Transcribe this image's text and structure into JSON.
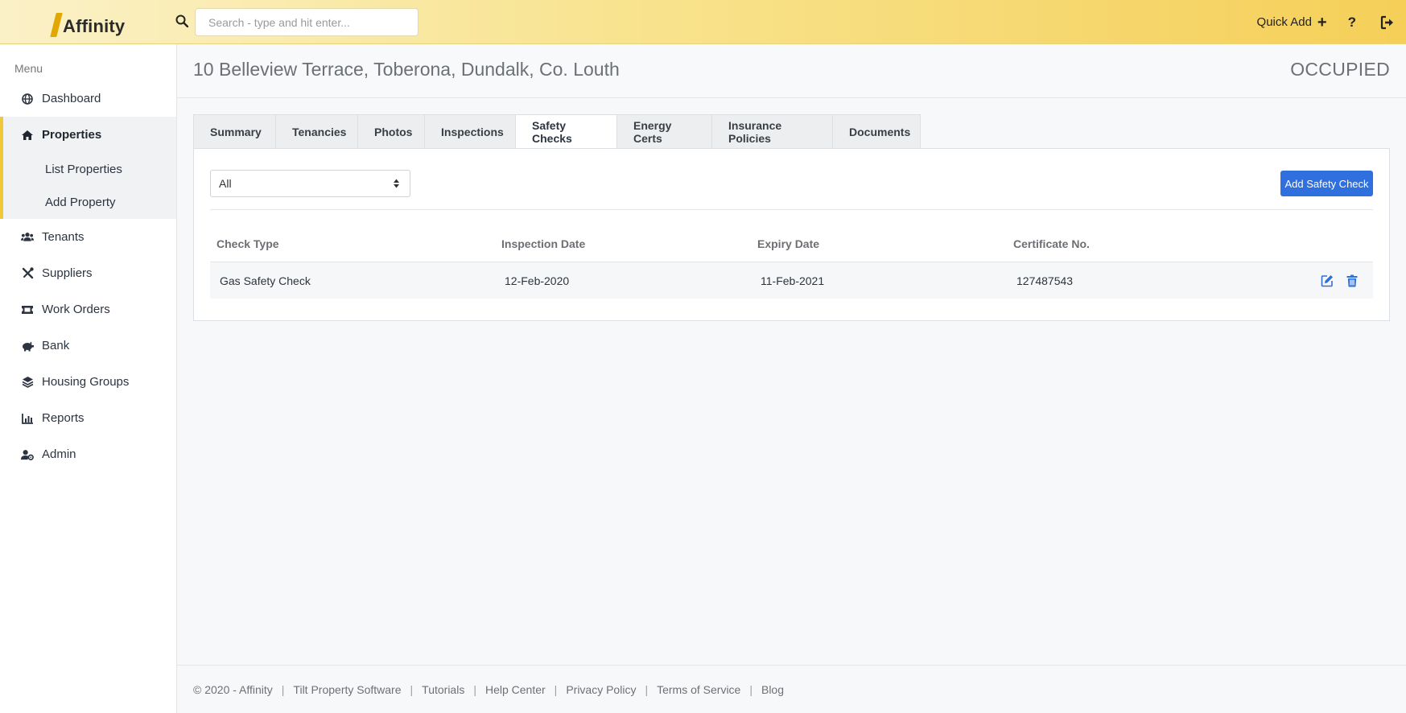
{
  "app": {
    "logo_text": "Affinity"
  },
  "topbar": {
    "search_placeholder": "Search - type and hit enter...",
    "quick_add_label": "Quick Add",
    "help_label": "?"
  },
  "sidebar": {
    "menu_label": "Menu",
    "items": [
      {
        "label": "Dashboard",
        "icon": "globe-icon"
      },
      {
        "label": "Properties",
        "icon": "home-icon",
        "active": true,
        "children": [
          {
            "label": "List Properties"
          },
          {
            "label": "Add Property"
          }
        ]
      },
      {
        "label": "Tenants",
        "icon": "users-icon"
      },
      {
        "label": "Suppliers",
        "icon": "tools-icon"
      },
      {
        "label": "Work Orders",
        "icon": "ticket-icon"
      },
      {
        "label": "Bank",
        "icon": "piggy-bank-icon"
      },
      {
        "label": "Housing Groups",
        "icon": "layers-icon"
      },
      {
        "label": "Reports",
        "icon": "chart-icon"
      },
      {
        "label": "Admin",
        "icon": "user-cog-icon"
      }
    ]
  },
  "page": {
    "title": "10 Belleview Terrace, Toberona, Dundalk, Co. Louth",
    "status": "OCCUPIED"
  },
  "tabs": [
    {
      "label": "Summary"
    },
    {
      "label": "Tenancies"
    },
    {
      "label": "Photos"
    },
    {
      "label": "Inspections"
    },
    {
      "label": "Safety Checks",
      "active": true
    },
    {
      "label": "Energy Certs"
    },
    {
      "label": "Insurance Policies"
    },
    {
      "label": "Documents"
    }
  ],
  "safety_checks": {
    "filter_value": "All",
    "add_button_label": "Add Safety Check",
    "columns": [
      "Check Type",
      "Inspection Date",
      "Expiry Date",
      "Certificate No."
    ],
    "rows": [
      {
        "check_type": "Gas Safety Check",
        "inspection_date": "12-Feb-2020",
        "expiry_date": "11-Feb-2021",
        "certificate_no": "127487543"
      }
    ]
  },
  "footer": {
    "copyright": "© 2020 - Affinity",
    "links": [
      "Tilt Property Software",
      "Tutorials",
      "Help Center",
      "Privacy Policy",
      "Terms of Service",
      "Blog"
    ]
  },
  "colors": {
    "accent_blue": "#2f6fde",
    "topbar_yellow": "#f5cf58",
    "active_indicator": "#f0c839"
  }
}
